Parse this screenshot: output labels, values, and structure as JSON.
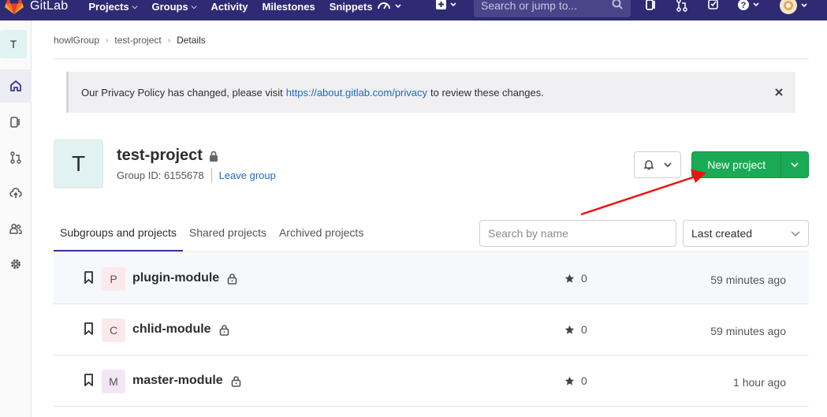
{
  "navbar": {
    "brand": "GitLab",
    "items": [
      {
        "label": "Projects",
        "caret": true
      },
      {
        "label": "Groups",
        "caret": true
      },
      {
        "label": "Activity",
        "caret": false
      },
      {
        "label": "Milestones",
        "caret": false
      },
      {
        "label": "Snippets",
        "caret": false
      }
    ],
    "search_placeholder": "Search or jump to...",
    "bg_color": "#2e2a74"
  },
  "sidebar": {
    "group_avatar_letter": "T",
    "items": [
      "home-icon",
      "issues-icon",
      "merge-requests-icon",
      "kubernetes-icon",
      "members-icon",
      "settings-icon"
    ]
  },
  "breadcrumb": {
    "items": [
      "howlGroup",
      "test-project",
      "Details"
    ]
  },
  "alert": {
    "text_before": "Our Privacy Policy has changed, please visit",
    "link": "https://about.gitlab.com/privacy",
    "text_after": "to review these changes."
  },
  "group": {
    "avatar_letter": "T",
    "name": "test-project",
    "id_label": "Group ID: 6155678",
    "leave_label": "Leave group"
  },
  "actions": {
    "new_project_label": "New project",
    "accent_color": "#1aaa55"
  },
  "tabs": [
    {
      "label": "Subgroups and projects",
      "active": true
    },
    {
      "label": "Shared projects",
      "active": false
    },
    {
      "label": "Archived projects",
      "active": false
    }
  ],
  "filter": {
    "search_placeholder": "Search by name",
    "sort_value": "Last created"
  },
  "projects": [
    {
      "letter": "P",
      "name": "plugin-module",
      "stars": "0",
      "updated": "59 minutes ago",
      "avatar_bg": "#fbe9eb"
    },
    {
      "letter": "C",
      "name": "chlid-module",
      "stars": "0",
      "updated": "59 minutes ago",
      "avatar_bg": "#fbe9eb"
    },
    {
      "letter": "M",
      "name": "master-module",
      "stars": "0",
      "updated": "1 hour ago",
      "avatar_bg": "#f3e5f5"
    }
  ]
}
